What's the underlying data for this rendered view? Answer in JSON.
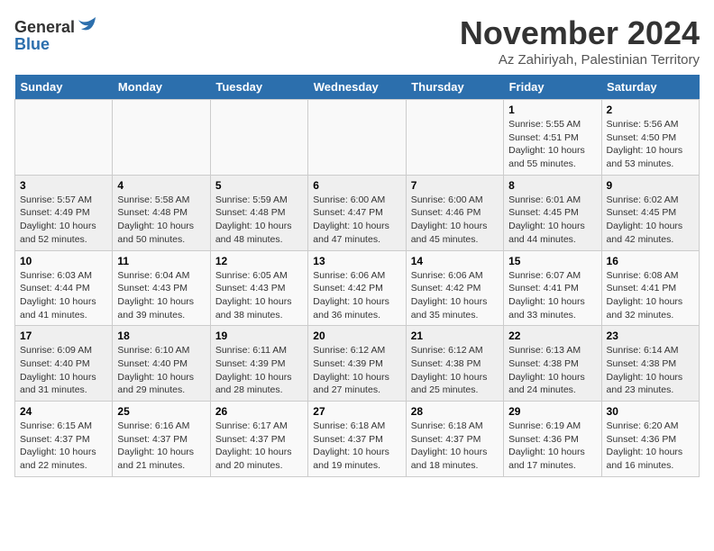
{
  "logo": {
    "general": "General",
    "blue": "Blue"
  },
  "title": "November 2024",
  "location": "Az Zahiriyah, Palestinian Territory",
  "weekdays": [
    "Sunday",
    "Monday",
    "Tuesday",
    "Wednesday",
    "Thursday",
    "Friday",
    "Saturday"
  ],
  "weeks": [
    [
      {
        "day": "",
        "info": ""
      },
      {
        "day": "",
        "info": ""
      },
      {
        "day": "",
        "info": ""
      },
      {
        "day": "",
        "info": ""
      },
      {
        "day": "",
        "info": ""
      },
      {
        "day": "1",
        "info": "Sunrise: 5:55 AM\nSunset: 4:51 PM\nDaylight: 10 hours\nand 55 minutes."
      },
      {
        "day": "2",
        "info": "Sunrise: 5:56 AM\nSunset: 4:50 PM\nDaylight: 10 hours\nand 53 minutes."
      }
    ],
    [
      {
        "day": "3",
        "info": "Sunrise: 5:57 AM\nSunset: 4:49 PM\nDaylight: 10 hours\nand 52 minutes."
      },
      {
        "day": "4",
        "info": "Sunrise: 5:58 AM\nSunset: 4:48 PM\nDaylight: 10 hours\nand 50 minutes."
      },
      {
        "day": "5",
        "info": "Sunrise: 5:59 AM\nSunset: 4:48 PM\nDaylight: 10 hours\nand 48 minutes."
      },
      {
        "day": "6",
        "info": "Sunrise: 6:00 AM\nSunset: 4:47 PM\nDaylight: 10 hours\nand 47 minutes."
      },
      {
        "day": "7",
        "info": "Sunrise: 6:00 AM\nSunset: 4:46 PM\nDaylight: 10 hours\nand 45 minutes."
      },
      {
        "day": "8",
        "info": "Sunrise: 6:01 AM\nSunset: 4:45 PM\nDaylight: 10 hours\nand 44 minutes."
      },
      {
        "day": "9",
        "info": "Sunrise: 6:02 AM\nSunset: 4:45 PM\nDaylight: 10 hours\nand 42 minutes."
      }
    ],
    [
      {
        "day": "10",
        "info": "Sunrise: 6:03 AM\nSunset: 4:44 PM\nDaylight: 10 hours\nand 41 minutes."
      },
      {
        "day": "11",
        "info": "Sunrise: 6:04 AM\nSunset: 4:43 PM\nDaylight: 10 hours\nand 39 minutes."
      },
      {
        "day": "12",
        "info": "Sunrise: 6:05 AM\nSunset: 4:43 PM\nDaylight: 10 hours\nand 38 minutes."
      },
      {
        "day": "13",
        "info": "Sunrise: 6:06 AM\nSunset: 4:42 PM\nDaylight: 10 hours\nand 36 minutes."
      },
      {
        "day": "14",
        "info": "Sunrise: 6:06 AM\nSunset: 4:42 PM\nDaylight: 10 hours\nand 35 minutes."
      },
      {
        "day": "15",
        "info": "Sunrise: 6:07 AM\nSunset: 4:41 PM\nDaylight: 10 hours\nand 33 minutes."
      },
      {
        "day": "16",
        "info": "Sunrise: 6:08 AM\nSunset: 4:41 PM\nDaylight: 10 hours\nand 32 minutes."
      }
    ],
    [
      {
        "day": "17",
        "info": "Sunrise: 6:09 AM\nSunset: 4:40 PM\nDaylight: 10 hours\nand 31 minutes."
      },
      {
        "day": "18",
        "info": "Sunrise: 6:10 AM\nSunset: 4:40 PM\nDaylight: 10 hours\nand 29 minutes."
      },
      {
        "day": "19",
        "info": "Sunrise: 6:11 AM\nSunset: 4:39 PM\nDaylight: 10 hours\nand 28 minutes."
      },
      {
        "day": "20",
        "info": "Sunrise: 6:12 AM\nSunset: 4:39 PM\nDaylight: 10 hours\nand 27 minutes."
      },
      {
        "day": "21",
        "info": "Sunrise: 6:12 AM\nSunset: 4:38 PM\nDaylight: 10 hours\nand 25 minutes."
      },
      {
        "day": "22",
        "info": "Sunrise: 6:13 AM\nSunset: 4:38 PM\nDaylight: 10 hours\nand 24 minutes."
      },
      {
        "day": "23",
        "info": "Sunrise: 6:14 AM\nSunset: 4:38 PM\nDaylight: 10 hours\nand 23 minutes."
      }
    ],
    [
      {
        "day": "24",
        "info": "Sunrise: 6:15 AM\nSunset: 4:37 PM\nDaylight: 10 hours\nand 22 minutes."
      },
      {
        "day": "25",
        "info": "Sunrise: 6:16 AM\nSunset: 4:37 PM\nDaylight: 10 hours\nand 21 minutes."
      },
      {
        "day": "26",
        "info": "Sunrise: 6:17 AM\nSunset: 4:37 PM\nDaylight: 10 hours\nand 20 minutes."
      },
      {
        "day": "27",
        "info": "Sunrise: 6:18 AM\nSunset: 4:37 PM\nDaylight: 10 hours\nand 19 minutes."
      },
      {
        "day": "28",
        "info": "Sunrise: 6:18 AM\nSunset: 4:37 PM\nDaylight: 10 hours\nand 18 minutes."
      },
      {
        "day": "29",
        "info": "Sunrise: 6:19 AM\nSunset: 4:36 PM\nDaylight: 10 hours\nand 17 minutes."
      },
      {
        "day": "30",
        "info": "Sunrise: 6:20 AM\nSunset: 4:36 PM\nDaylight: 10 hours\nand 16 minutes."
      }
    ]
  ]
}
